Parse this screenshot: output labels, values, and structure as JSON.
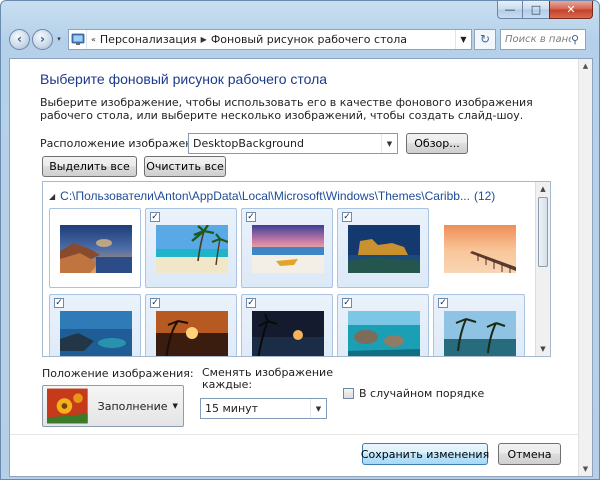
{
  "window": {
    "minimize": "—",
    "maximize": "□",
    "close": "✕"
  },
  "nav": {
    "back": "‹",
    "forward": "›",
    "recent_drop": "▾",
    "crumb_sep": "«",
    "breadcrumbs": [
      "Персонализация",
      "Фоновый рисунок рабочего стола"
    ],
    "refresh": "↻",
    "search_placeholder": "Поиск в пане..."
  },
  "page": {
    "title": "Выберите фоновый рисунок рабочего стола",
    "description": "Выберите изображение, чтобы использовать его в качестве фонового изображения рабочего стола, или выберите несколько изображений, чтобы создать слайд-шоу."
  },
  "location": {
    "label": "Расположение изображения:",
    "value": "DesktopBackground",
    "browse_button": "Обзор..."
  },
  "selection": {
    "select_all": "Выделить все",
    "clear_all": "Очистить все"
  },
  "gallery": {
    "group_path": "C:\\Пользователи\\Anton\\AppData\\Local\\Microsoft\\Windows\\Themes\\Caribb...",
    "group_count": "(12)",
    "tiles": [
      {
        "checked": false,
        "check_mark": "",
        "scene": "rocky-bay-sunset"
      },
      {
        "checked": true,
        "check_mark": "✓",
        "scene": "palm-beach"
      },
      {
        "checked": true,
        "check_mark": "✓",
        "scene": "beach-boat"
      },
      {
        "checked": true,
        "check_mark": "✓",
        "scene": "fortress-coast"
      },
      {
        "checked": false,
        "check_mark": "",
        "scene": "pier-sunset"
      },
      {
        "checked": true,
        "check_mark": "✓",
        "scene": "lagoon-rocks"
      },
      {
        "checked": true,
        "check_mark": "✓",
        "scene": "sunset-dusk"
      },
      {
        "checked": true,
        "check_mark": "✓",
        "scene": "palm-silhouette"
      },
      {
        "checked": true,
        "check_mark": "✓",
        "scene": "island-boulders"
      },
      {
        "checked": true,
        "check_mark": "✓",
        "scene": "palm-grove"
      }
    ]
  },
  "position": {
    "label": "Положение изображения:",
    "value": "Заполнение"
  },
  "interval": {
    "label": "Сменять изображение каждые:",
    "value": "15 минут"
  },
  "shuffle": {
    "label": "В случайном порядке",
    "checked": false
  },
  "actions": {
    "save": "Сохранить изменения",
    "cancel": "Отмена"
  }
}
